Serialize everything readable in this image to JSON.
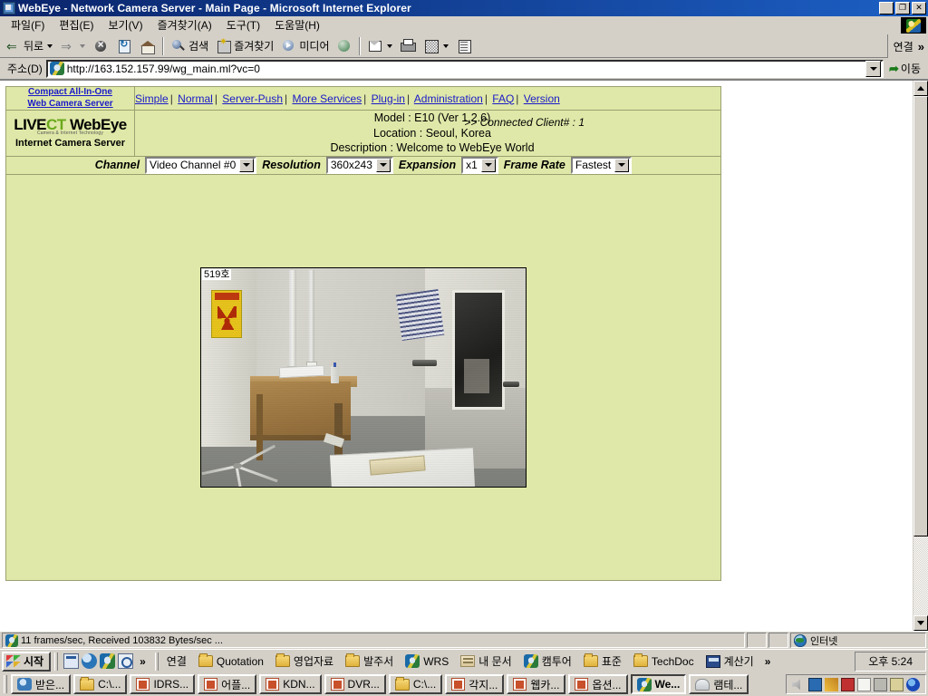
{
  "window": {
    "title": "WebEye - Network Camera Server - Main Page - Microsoft Internet Explorer",
    "minimize": "_",
    "restore": "❐",
    "close": "✕"
  },
  "menu": [
    {
      "label": "파일(F)"
    },
    {
      "label": "편집(E)"
    },
    {
      "label": "보기(V)"
    },
    {
      "label": "즐겨찾기(A)"
    },
    {
      "label": "도구(T)"
    },
    {
      "label": "도움말(H)"
    }
  ],
  "toolbar": {
    "back": "뒤로",
    "forward": "",
    "stop": "",
    "refresh": "",
    "home": "",
    "search": "검색",
    "favorites": "즐겨찾기",
    "media": "미디어",
    "history": "",
    "mail": "",
    "print": "",
    "edit": "",
    "discuss": "",
    "links_label": "연결",
    "overflow": "»"
  },
  "address": {
    "label": "주소(D)",
    "url": "http://163.152.157.99/wg_main.ml?vc=0",
    "go_label": "이동"
  },
  "page": {
    "brand_link_line1": "Compact All-In-One",
    "brand_link_line2": "Web Camera Server",
    "nav": [
      "Simple",
      "Normal",
      "Server-Push",
      "More Services",
      "Plug-in",
      "Administration",
      "FAQ",
      "Version"
    ],
    "nav_separator": "|",
    "logo": {
      "live": "LIVE",
      "ct": "CT",
      "tagline": "Camera & Internet Technology",
      "webeye": "WebEye",
      "subtitle": "Internet Camera Server"
    },
    "info": {
      "model": "Model : E10 (Ver 1.2.6)",
      "location": "Location : Seoul, Korea",
      "description": "Description : Welcome to WebEye World",
      "connected": ">> Connected Client# : 1"
    },
    "controls": {
      "channel_label": "Channel",
      "channel_value": "Video Channel #0",
      "resolution_label": "Resolution",
      "resolution_value": "360x243",
      "expansion_label": "Expansion",
      "expansion_value": "x1",
      "framerate_label": "Frame Rate",
      "framerate_value": "Fastest"
    },
    "video": {
      "osd_label": "519호"
    }
  },
  "statusbar": {
    "text": "11 frames/sec, Received 103832 Bytes/sec ...",
    "zone": "인터넷"
  },
  "taskbar": {
    "start": "시작",
    "overflow": "»",
    "clock": "오후 5:24",
    "row1": [
      {
        "label": "연결",
        "icon": "none"
      },
      {
        "label": "Quotation",
        "icon": "folder"
      },
      {
        "label": "영업자료",
        "icon": "folder"
      },
      {
        "label": "발주서",
        "icon": "folder"
      },
      {
        "label": "WRS",
        "icon": "ie"
      },
      {
        "label": "내 문서",
        "icon": "mydocs"
      },
      {
        "label": "캠투어",
        "icon": "ie"
      },
      {
        "label": "표준",
        "icon": "folder"
      },
      {
        "label": "TechDoc",
        "icon": "folder"
      },
      {
        "label": "계산기",
        "icon": "calc"
      }
    ],
    "row2": [
      {
        "label": "받은...",
        "icon": "net",
        "active": false
      },
      {
        "label": "C:\\...",
        "icon": "folder",
        "active": false
      },
      {
        "label": "IDRS...",
        "icon": "doc",
        "active": false
      },
      {
        "label": "어플...",
        "icon": "doc",
        "active": false
      },
      {
        "label": "KDN...",
        "icon": "doc",
        "active": false
      },
      {
        "label": "DVR...",
        "icon": "doc",
        "active": false
      },
      {
        "label": "C:\\...",
        "icon": "folder",
        "active": false
      },
      {
        "label": "각지...",
        "icon": "doc",
        "active": false
      },
      {
        "label": "웹카...",
        "icon": "doc",
        "active": false
      },
      {
        "label": "옵션...",
        "icon": "doc",
        "active": false
      },
      {
        "label": "We...",
        "icon": "ie",
        "active": true
      },
      {
        "label": "램테...",
        "icon": "lamp",
        "active": false
      }
    ]
  }
}
